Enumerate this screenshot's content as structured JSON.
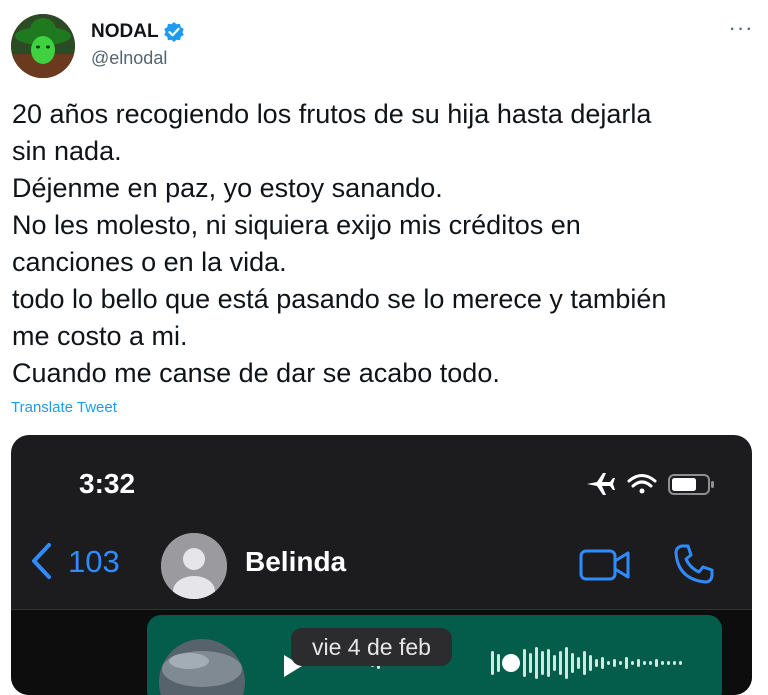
{
  "author": {
    "name": "NODAL",
    "handle": "@elnodal",
    "verified": true
  },
  "menu": {
    "more_label": "···"
  },
  "tweet": {
    "text": "20 años recogiendo los frutos de su hija hasta dejarla\nsin nada.\nDéjenme en paz, yo estoy sanando.\nNo les molesto, ni siquiera exijo mis créditos en\ncanciones o en la vida.\ntodo lo bello que está pasando se lo merece y también\nme costo a mi.\nCuando me canse de dar se acabo todo.",
    "translate_label": "Translate Tweet"
  },
  "media": {
    "status_time": "3:32",
    "status_icons": [
      "airplane-icon",
      "wifi-icon",
      "battery-icon"
    ],
    "back_count": "103",
    "contact_name": "Belinda",
    "header_icons": [
      "video-call-icon",
      "phone-icon"
    ],
    "date_label": "vie 4 de feb"
  },
  "colors": {
    "link": "#1d9bf0",
    "verified": "#1d9bf0",
    "ios_blue": "#2f8cff",
    "bubble_green": "#045c4a",
    "phone_dark": "#1c1c1e"
  }
}
